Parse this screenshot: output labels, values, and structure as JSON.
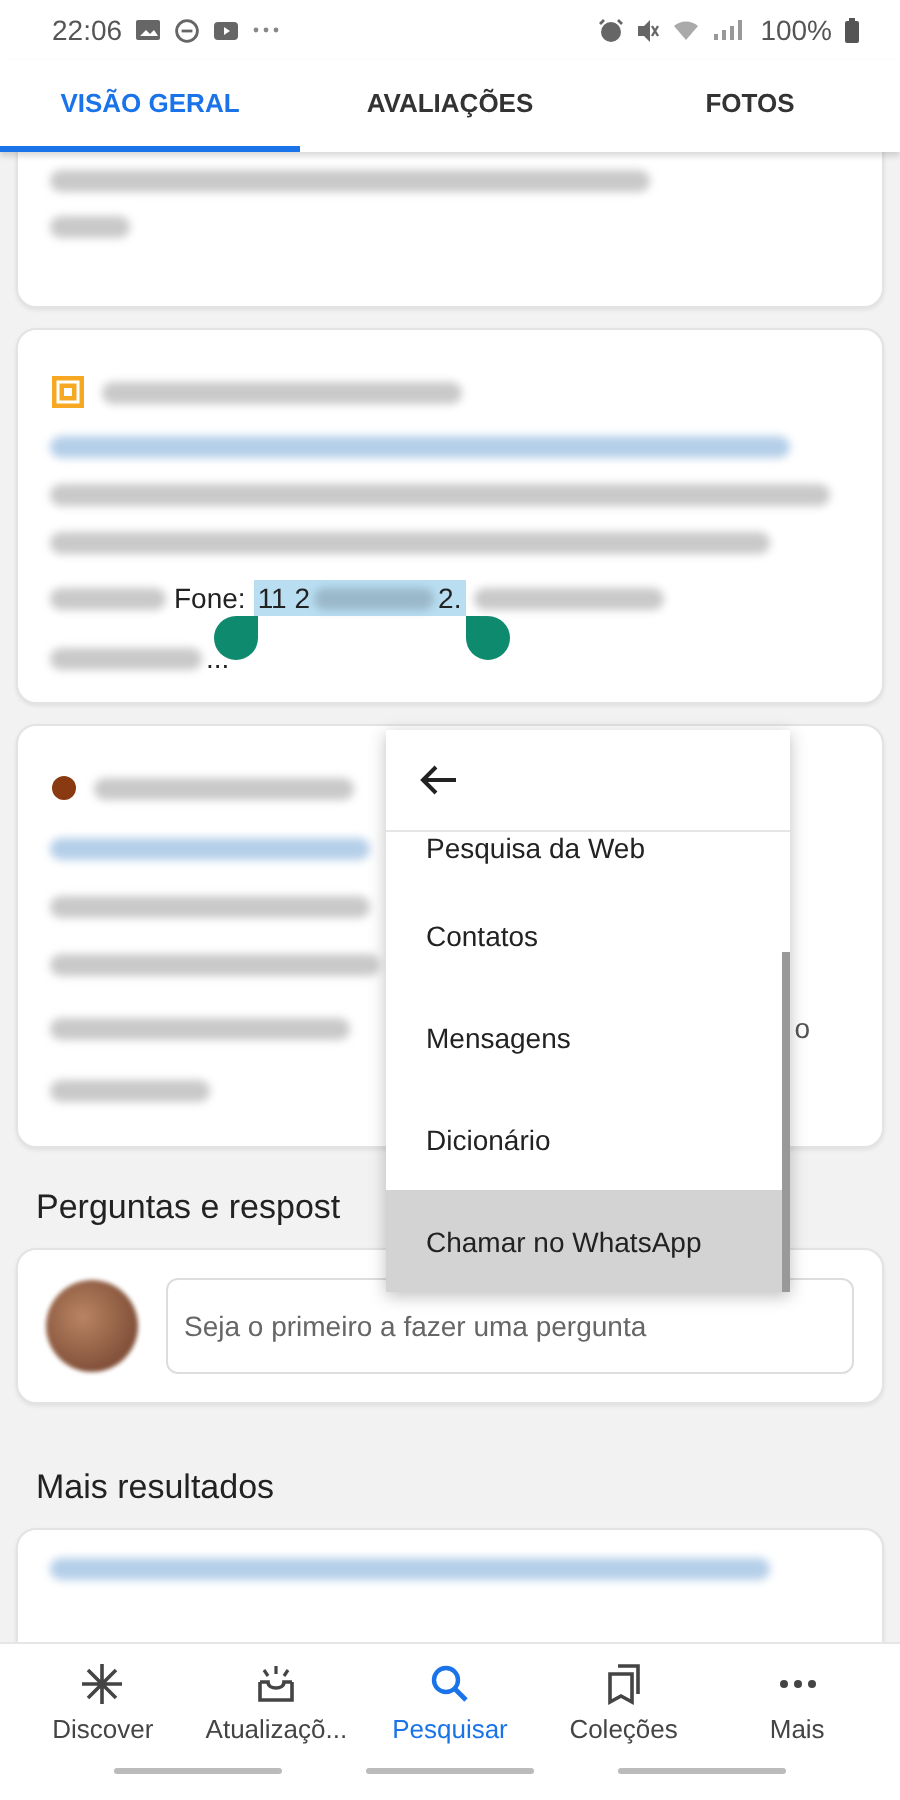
{
  "status_bar": {
    "time": "22:06",
    "battery": "100%"
  },
  "tabs": [
    {
      "label": "VISÃO GERAL",
      "selected": true
    },
    {
      "label": "AVALIAÇÕES",
      "selected": false
    },
    {
      "label": "FOTOS",
      "selected": false
    }
  ],
  "listing_card": {
    "phone_label": "Fone:",
    "selected_start": "11 2",
    "selected_end": "2.",
    "ellipsis": "..."
  },
  "second_card": {
    "text_fragment": "o"
  },
  "questions": {
    "title": "Perguntas e respost",
    "placeholder": "Seja o primeiro a fazer uma pergunta"
  },
  "more_results": {
    "title": "Mais resultados"
  },
  "context_menu": {
    "items": [
      {
        "label": "Pesquisa da Web",
        "selected": false
      },
      {
        "label": "Contatos",
        "selected": false
      },
      {
        "label": "Mensagens",
        "selected": false
      },
      {
        "label": "Dicionário",
        "selected": false
      },
      {
        "label": "Chamar no WhatsApp",
        "selected": true
      }
    ]
  },
  "bottom_nav": [
    {
      "label": "Discover",
      "selected": false
    },
    {
      "label": "Atualizaçõ...",
      "selected": false
    },
    {
      "label": "Pesquisar",
      "selected": true
    },
    {
      "label": "Coleções",
      "selected": false
    },
    {
      "label": "Mais",
      "selected": false
    }
  ]
}
